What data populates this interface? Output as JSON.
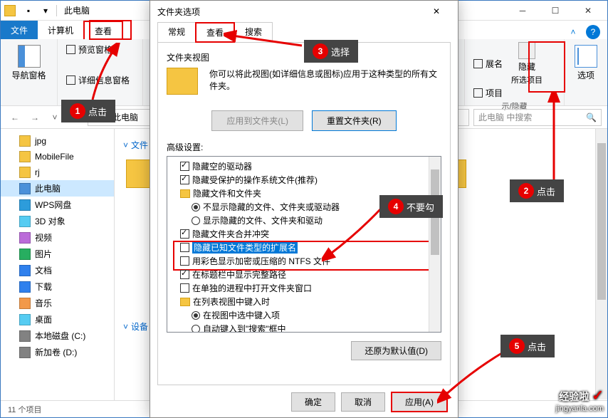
{
  "explorer": {
    "title": "此电脑",
    "tabs": {
      "file": "文件",
      "computer": "计算机",
      "view": "查看"
    },
    "ribbon": {
      "navpane": "导航窗格",
      "preview": "预览窗格",
      "detail": "详细信息窗格",
      "hide_label": "隐藏",
      "hide_sub": "所选项目",
      "ext_label": "展名",
      "item_label": "项目",
      "options": "选项",
      "group_showhide": "示/隐藏"
    },
    "address": {
      "location": "此电脑",
      "search_ph": "此电脑 中搜索"
    },
    "sidebar": {
      "items": [
        {
          "label": "jpg",
          "type": "folder"
        },
        {
          "label": "MobileFile",
          "type": "folder"
        },
        {
          "label": "rj",
          "type": "folder"
        },
        {
          "label": "此电脑",
          "type": "pc",
          "selected": true
        },
        {
          "label": "WPS网盘",
          "type": "cloud"
        },
        {
          "label": "3D 对象",
          "type": "3d"
        },
        {
          "label": "视频",
          "type": "video"
        },
        {
          "label": "图片",
          "type": "image"
        },
        {
          "label": "文档",
          "type": "doc"
        },
        {
          "label": "下载",
          "type": "download"
        },
        {
          "label": "音乐",
          "type": "music"
        },
        {
          "label": "桌面",
          "type": "desktop"
        },
        {
          "label": "本地磁盘 (C:)",
          "type": "disk"
        },
        {
          "label": "新加卷 (D:)",
          "type": "disk"
        }
      ]
    },
    "content": {
      "folders_header": "文件",
      "devices_header": "设备"
    },
    "status": "11 个项目"
  },
  "dialog": {
    "title": "文件夹选项",
    "tabs": {
      "general": "常规",
      "view": "查看",
      "search": "搜索"
    },
    "folderview": {
      "header": "文件夹视图",
      "desc": "你可以将此视图(如详细信息或图标)应用于这种类型的所有文件夹。",
      "apply_btn": "应用到文件夹(L)",
      "reset_btn": "重置文件夹(R)"
    },
    "advanced": {
      "header": "高级设置:",
      "nodes": [
        {
          "lvl": 1,
          "type": "cb",
          "checked": true,
          "label": "隐藏空的驱动器"
        },
        {
          "lvl": 1,
          "type": "cb",
          "checked": true,
          "label": "隐藏受保护的操作系统文件(推荐)"
        },
        {
          "lvl": 1,
          "type": "folder",
          "label": "隐藏文件和文件夹"
        },
        {
          "lvl": 2,
          "type": "rd",
          "checked": true,
          "label": "不显示隐藏的文件、文件夹或驱动器"
        },
        {
          "lvl": 2,
          "type": "rd",
          "checked": false,
          "label": "显示隐藏的文件、文件夹和驱动"
        },
        {
          "lvl": 1,
          "type": "cb",
          "checked": true,
          "label": "隐藏文件夹合并冲突"
        },
        {
          "lvl": 1,
          "type": "cb",
          "checked": false,
          "label": "隐藏已知文件类型的扩展名",
          "highlight": true
        },
        {
          "lvl": 1,
          "type": "cb",
          "checked": false,
          "label": "用彩色显示加密或压缩的 NTFS 文件"
        },
        {
          "lvl": 1,
          "type": "cb",
          "checked": true,
          "label": "在标题栏中显示完整路径"
        },
        {
          "lvl": 1,
          "type": "cb",
          "checked": false,
          "label": "在单独的进程中打开文件夹窗口"
        },
        {
          "lvl": 1,
          "type": "folder",
          "label": "在列表视图中键入时"
        },
        {
          "lvl": 2,
          "type": "rd",
          "checked": true,
          "label": "在视图中选中键入项"
        },
        {
          "lvl": 2,
          "type": "rd",
          "checked": false,
          "label": "自动键入到\"搜索\"框中"
        }
      ],
      "restore_btn": "还原为默认值(D)"
    },
    "buttons": {
      "ok": "确定",
      "cancel": "取消",
      "apply": "应用(A)"
    }
  },
  "annotations": {
    "a1": "点击",
    "a2": "点击",
    "a3": "选择",
    "a4": "不要勾",
    "a5": "点击"
  },
  "watermark": {
    "brand": "经验啦",
    "domain": "jingyanla.com"
  }
}
